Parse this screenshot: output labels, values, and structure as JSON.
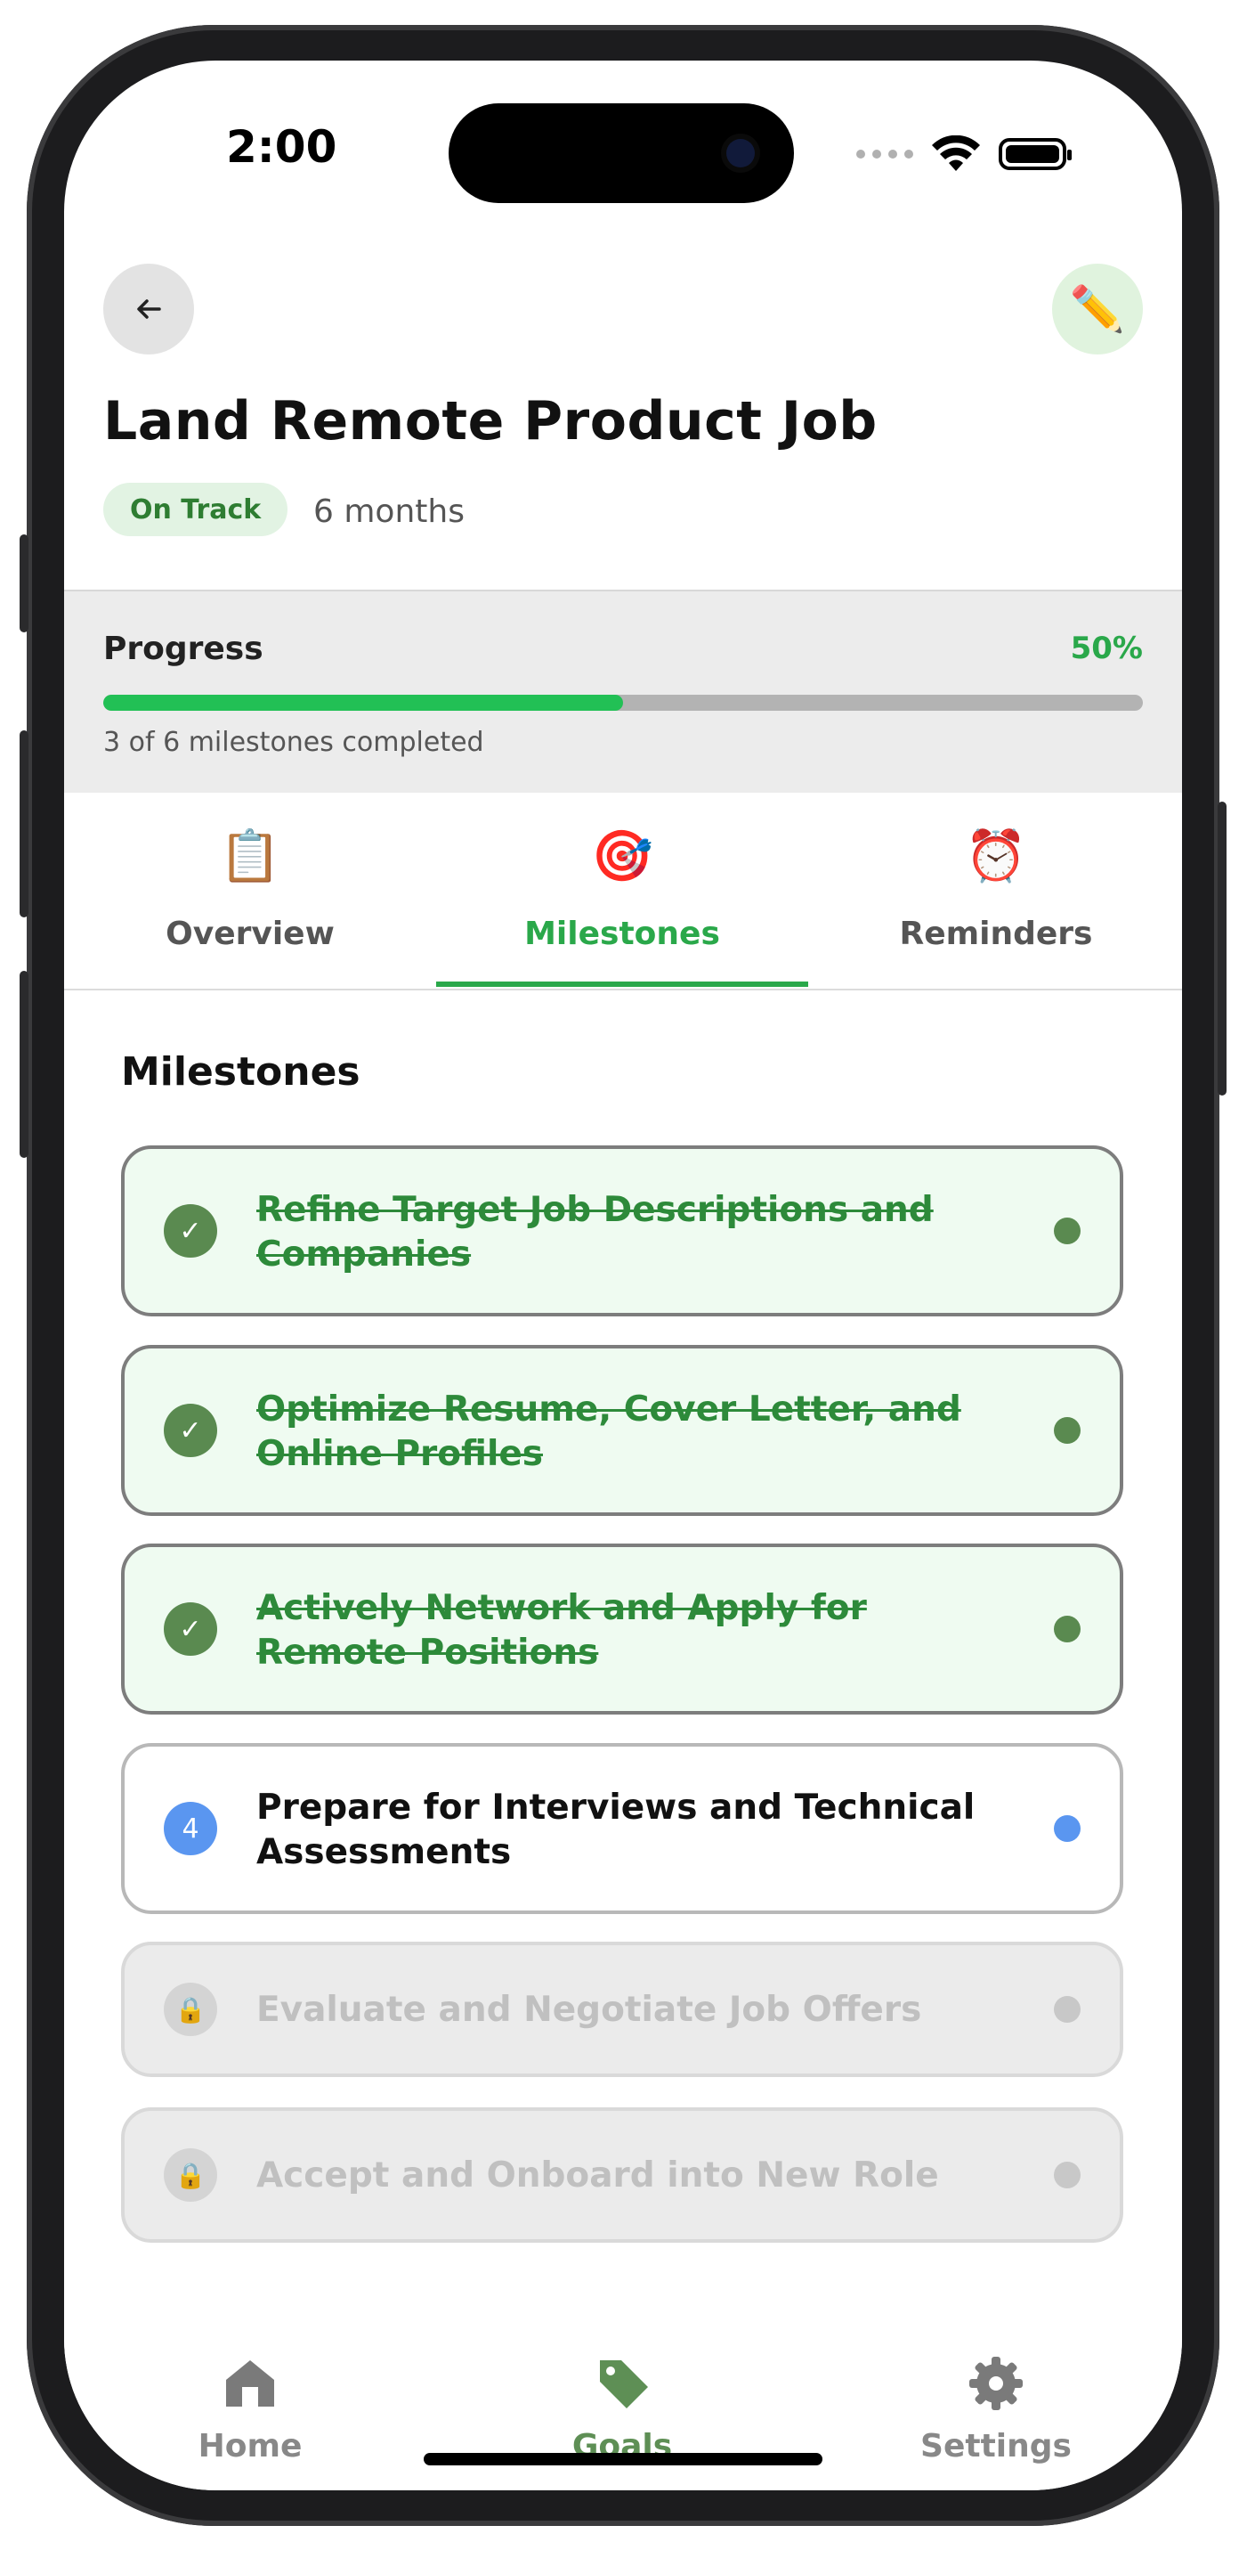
{
  "status_bar": {
    "time": "2:00"
  },
  "header": {
    "title": "Land Remote Product Job",
    "status_badge": "On Track",
    "duration": "6 months",
    "edit_icon": "✏️"
  },
  "progress": {
    "label": "Progress",
    "percent_text": "50%",
    "fraction": 0.5,
    "summary": "3 of 6 milestones completed"
  },
  "tabs": [
    {
      "label": "Overview",
      "icon": "📋",
      "active": false
    },
    {
      "label": "Milestones",
      "icon": "🎯",
      "active": true
    },
    {
      "label": "Reminders",
      "icon": "⏰",
      "active": false
    }
  ],
  "milestones_section": {
    "title": "Milestones",
    "items": [
      {
        "badge": "✓",
        "text": "Refine Target Job Descriptions and Companies",
        "state": "completed"
      },
      {
        "badge": "✓",
        "text": "Optimize Resume, Cover Letter, and Online Profiles",
        "state": "completed"
      },
      {
        "badge": "✓",
        "text": "Actively Network and Apply for Remote Positions",
        "state": "completed"
      },
      {
        "badge": "4",
        "text": "Prepare for Interviews and Technical Assessments",
        "state": "current"
      },
      {
        "badge": "🔒",
        "text": "Evaluate and Negotiate Job Offers",
        "state": "locked"
      },
      {
        "badge": "🔒",
        "text": "Accept and Onboard into New Role",
        "state": "locked"
      }
    ]
  },
  "bottom_nav": [
    {
      "label": "Home",
      "icon": "home-icon",
      "active": false
    },
    {
      "label": "Goals",
      "icon": "tag-icon",
      "active": true
    },
    {
      "label": "Settings",
      "icon": "gear-icon",
      "active": false
    }
  ],
  "colors": {
    "accent_green": "#2aa84a",
    "completed_badge": "#5a8a50",
    "current_blue": "#5a96f0",
    "nav_active": "#5e8f55"
  }
}
